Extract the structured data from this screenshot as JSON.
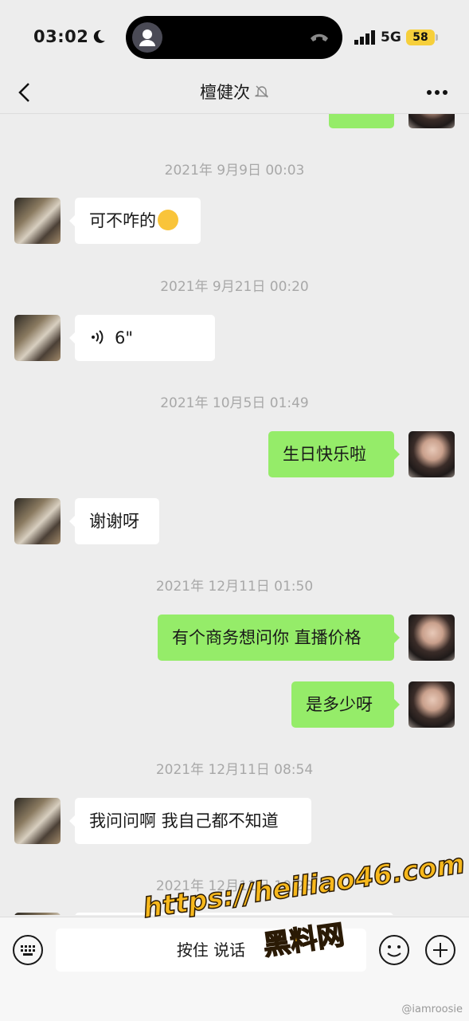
{
  "status": {
    "time": "03:02",
    "network": "5G",
    "battery": "58"
  },
  "nav": {
    "title": "檀健次"
  },
  "messages": {
    "ts1": "2021年 9月9日 00:03",
    "m1": "可不咋的",
    "ts2": "2021年 9月21日 00:20",
    "voice": "6\"",
    "ts3": "2021年 10月5日 01:49",
    "m3": "生日快乐啦",
    "m4": "谢谢呀",
    "ts4": "2021年 12月11日 01:50",
    "m5": "有个商务想问你 直播价格",
    "m6": "是多少呀",
    "ts5": "2021年 12月11日 08:54",
    "m7": "我问问啊 我自己都不知道",
    "ts6": "2021年 12月11日 10:28"
  },
  "input": {
    "hold_to_talk": "按住 说话"
  },
  "watermark": {
    "url": "https://heiliao46.com",
    "site": "黑料网",
    "weibo": "@iamroosie"
  },
  "icons": [
    "moon-icon",
    "phone-end-icon",
    "signal-icon",
    "back-icon",
    "mute-bell-icon",
    "more-icon",
    "voice-icon",
    "keyboard-icon",
    "emoji-icon",
    "plus-icon"
  ]
}
